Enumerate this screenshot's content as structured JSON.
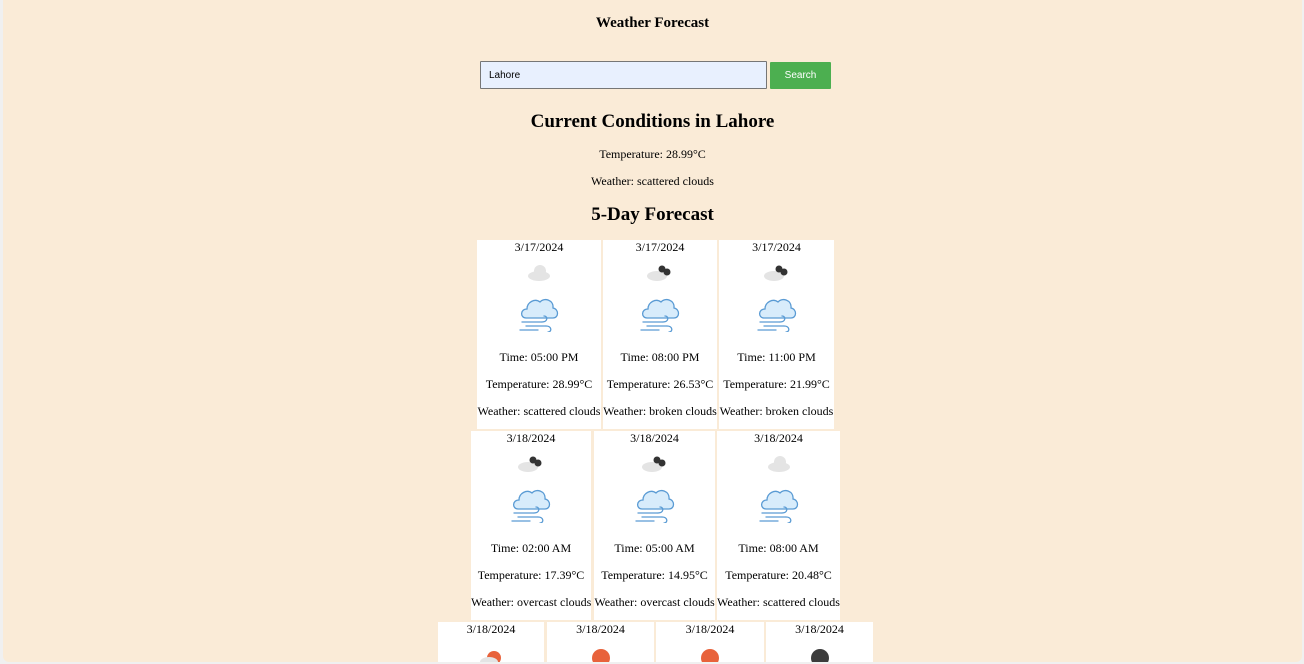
{
  "app": {
    "title": "Weather Forecast"
  },
  "search": {
    "value": "Lahore",
    "button_label": "Search"
  },
  "current": {
    "heading": "Current Conditions in Lahore",
    "temperature": "Temperature: 28.99°C",
    "weather": "Weather: scattered clouds"
  },
  "forecast": {
    "heading": "5-Day Forecast",
    "row1": [
      {
        "date": "3/17/2024",
        "icon": "scattered-clouds-icon",
        "time": "Time: 05:00 PM",
        "temp": "Temperature: 28.99°C",
        "weather": "Weather: scattered clouds"
      },
      {
        "date": "3/17/2024",
        "icon": "broken-clouds-icon",
        "time": "Time: 08:00 PM",
        "temp": "Temperature: 26.53°C",
        "weather": "Weather: broken clouds"
      },
      {
        "date": "3/17/2024",
        "icon": "broken-clouds-icon",
        "time": "Time: 11:00 PM",
        "temp": "Temperature: 21.99°C",
        "weather": "Weather: broken clouds"
      }
    ],
    "row2": [
      {
        "date": "3/18/2024",
        "icon": "overcast-clouds-icon",
        "time": "Time: 02:00 AM",
        "temp": "Temperature: 17.39°C",
        "weather": "Weather: overcast clouds"
      },
      {
        "date": "3/18/2024",
        "icon": "overcast-clouds-icon",
        "time": "Time: 05:00 AM",
        "temp": "Temperature: 14.95°C",
        "weather": "Weather: overcast clouds"
      },
      {
        "date": "3/18/2024",
        "icon": "scattered-clouds-icon",
        "time": "Time: 08:00 AM",
        "temp": "Temperature: 20.48°C",
        "weather": "Weather: scattered clouds"
      }
    ],
    "row3": [
      {
        "date": "3/18/2024",
        "icon": "few-clouds-day-icon"
      },
      {
        "date": "3/18/2024",
        "icon": "clear-sky-day-icon"
      },
      {
        "date": "3/18/2024",
        "icon": "clear-sky-day-icon"
      },
      {
        "date": "3/18/2024",
        "icon": "clear-sky-night-icon"
      }
    ]
  },
  "colors": {
    "background": "#faebd7",
    "search_button": "#4caf50",
    "input_bg": "#e8f0fe"
  }
}
